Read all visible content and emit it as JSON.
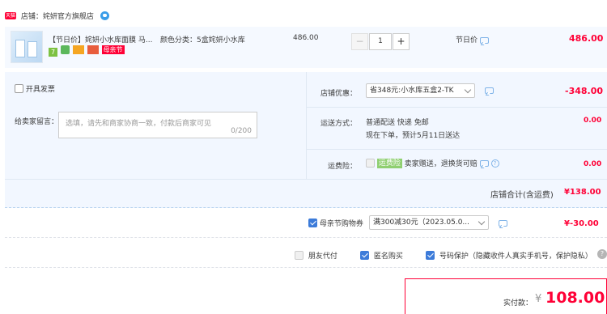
{
  "shop": {
    "badge": "天猫",
    "label": "店铺：",
    "name": "姹妍官方旗舰店"
  },
  "item": {
    "title": "【节日价】姹妍小水库面膜 马...",
    "spec_label": "颜色分类：",
    "spec_value": "5盒姹妍小水库",
    "price": "486.00",
    "qty": "1",
    "minus": "−",
    "plus": "+",
    "promo": "节日价",
    "subtotal": "486.00",
    "tag_festival": "母亲节"
  },
  "invoice": {
    "label": "开具发票"
  },
  "message": {
    "label": "给卖家留言：",
    "placeholder": "选填，请先和商家协商一致，付款后商家可见",
    "counter": "0/200"
  },
  "discount": {
    "label": "店铺优惠：",
    "value": "省348元:小水库五盒2-TK",
    "amount": "-348.00"
  },
  "shipping": {
    "label": "运送方式：",
    "method": "普通配送 快递 免邮",
    "eta": "现在下单，预计5月11日送达",
    "amount": "0.00"
  },
  "insurance": {
    "label": "运费险：",
    "tag": "运费险",
    "text": "卖家赠送，退换货可赔",
    "amount": "0.00"
  },
  "shop_total": {
    "label": "店铺合计(含运费)",
    "amount": "¥138.00"
  },
  "voucher": {
    "label": "母亲节购物券",
    "value": "满300减30元（2023.05.0...",
    "amount": "¥-30.00"
  },
  "options": {
    "friend_pay": "朋友代付",
    "anonymous": "匿名购买",
    "privacy": "号码保护（隐藏收件人真实手机号，保护隐私）",
    "help": "?"
  },
  "payment": {
    "label": "实付款：",
    "currency": "¥",
    "amount": "108.00"
  },
  "colors": {
    "accent": "#ff0036",
    "panel": "#f2f7ff",
    "border": "#b8d3f0"
  }
}
